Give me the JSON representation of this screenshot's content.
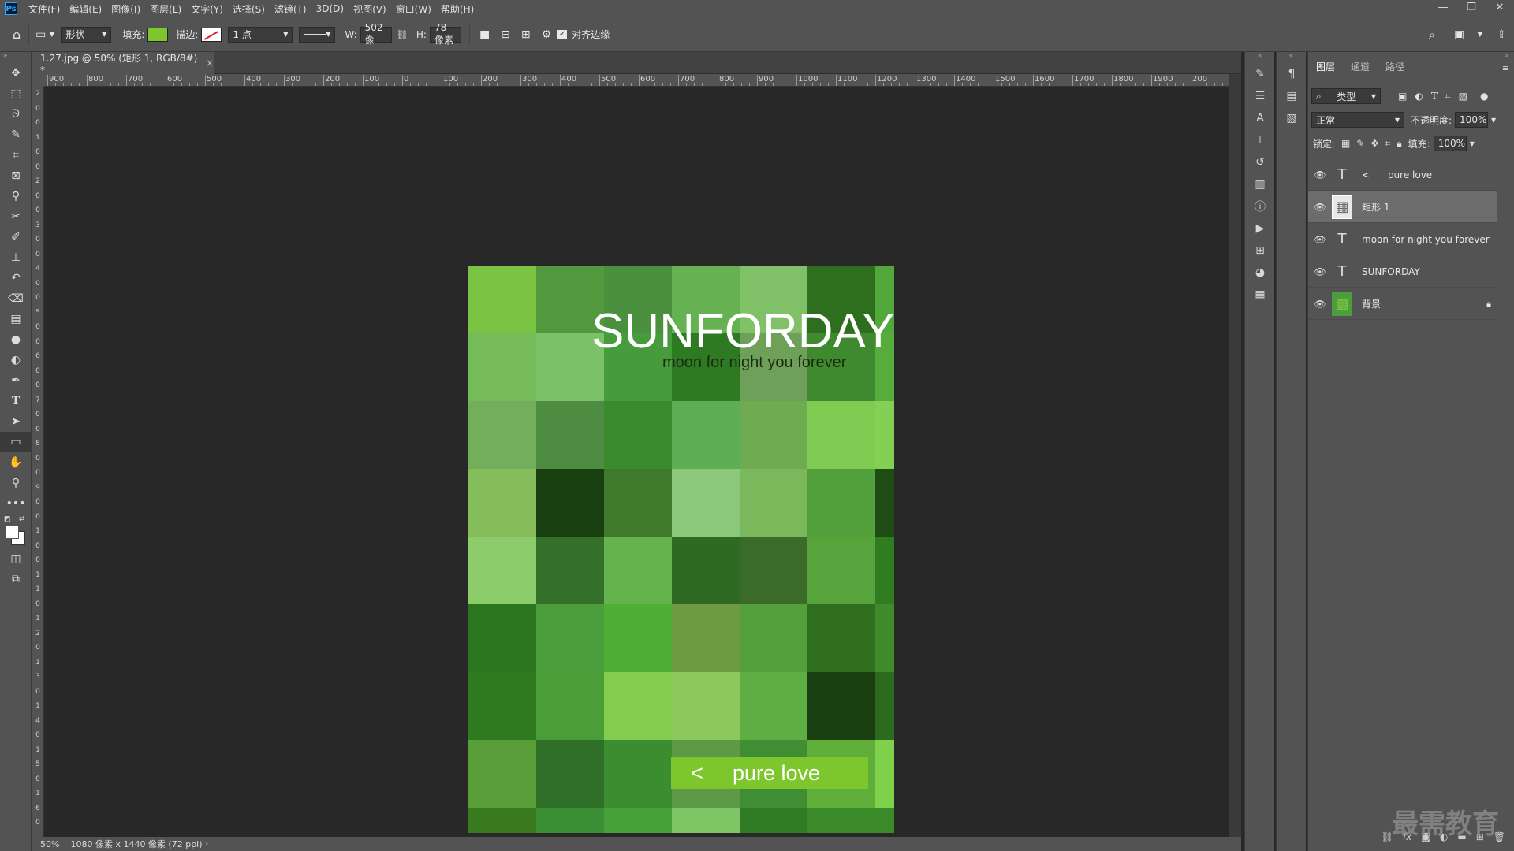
{
  "app": {
    "logo": "Ps"
  },
  "menu": [
    "文件(F)",
    "编辑(E)",
    "图像(I)",
    "图层(L)",
    "文字(Y)",
    "选择(S)",
    "滤镜(T)",
    "3D(D)",
    "视图(V)",
    "窗口(W)",
    "帮助(H)"
  ],
  "window_controls": {
    "minimize": "—",
    "restore": "❐",
    "close": "✕"
  },
  "options": {
    "mode": "形状",
    "fill_label": "填充:",
    "fill_color": "#7ec62d",
    "stroke_label": "描边:",
    "stroke_size": "1 点",
    "w_label": "W:",
    "w_value": "502 像",
    "h_label": "H:",
    "h_value": "78 像素",
    "align_edges_label": "对齐边缘"
  },
  "document": {
    "tab_title": "1.27.jpg @ 50% (矩形 1, RGB/8#) *",
    "tab_close": "×"
  },
  "ruler_h": [
    "900",
    "800",
    "700",
    "600",
    "500",
    "400",
    "300",
    "200",
    "100",
    "0",
    "100",
    "200",
    "300",
    "400",
    "500",
    "600",
    "700",
    "800",
    "900",
    "1000",
    "1100",
    "1200",
    "1300",
    "1400",
    "1500",
    "1600",
    "1700",
    "1800",
    "1900",
    "200"
  ],
  "ruler_v": [
    "2",
    "0",
    "0",
    "1",
    "0",
    "0",
    "2",
    "0",
    "0",
    "3",
    "0",
    "0",
    "4",
    "0",
    "0",
    "5",
    "0",
    "0",
    "6",
    "0",
    "0",
    "7",
    "0",
    "0",
    "8",
    "0",
    "0",
    "9",
    "0",
    "0",
    "1",
    "0",
    "0",
    "1",
    "1",
    "0",
    "1",
    "2",
    "0",
    "1",
    "3",
    "0",
    "1",
    "4",
    "0",
    "1",
    "5",
    "0",
    "1",
    "6",
    "0"
  ],
  "poster": {
    "title": "SUNFORDAY",
    "subtitle": "moon for night you forever",
    "button_arrow": "<",
    "button_text": "pure love",
    "tiles": [
      [
        "#7bc443",
        "#52983d",
        "#4b903f",
        "#66b152",
        "#80c066",
        "#2d6f1f",
        "#52a83a"
      ],
      [
        "#75bb59",
        "#7bc168",
        "#469c3c",
        "#2e7a22",
        "#6ea05a",
        "#3f8a2f",
        "#58ac3c"
      ],
      [
        "#73ae5a",
        "#4e8c42",
        "#3a8a2e",
        "#5dae55",
        "#6fab50",
        "#80cc52",
        "#83d054"
      ],
      [
        "#86bd5b",
        "#173f10",
        "#3f7a2c",
        "#8cc87c",
        "#7ab85b",
        "#52a03c",
        "#1f4c14"
      ],
      [
        "#8ccc6a",
        "#33702a",
        "#63b44c",
        "#2f6a22",
        "#3a6b2a",
        "#58a43c",
        "#2f7d1f"
      ],
      [
        "#2c751f",
        "#4c9e3c",
        "#4fae36",
        "#6e9a44",
        "#53a03c",
        "#2f6f1f",
        "#3f8a2a"
      ],
      [
        "#2f7a1f",
        "#4a9e3a",
        "#82cc4e",
        "#8cc85c",
        "#5fae44",
        "#1a3f10",
        "#2c6b1f"
      ],
      [
        "#5a9e3a",
        "#2f7028",
        "#3a8e30",
        "#5e9a46",
        "#3f8e34",
        "#5fae3a",
        "#7fd04a"
      ],
      [
        "#3a7a1f",
        "#3a8e34",
        "#47a03a",
        "#7ec666",
        "#2f7c24",
        "#3a8a2a",
        "#3a8a2a"
      ]
    ]
  },
  "status": {
    "zoom": "50%",
    "info": "1080 像素 x 1440 像素 (72 ppi)"
  },
  "layers_panel": {
    "tabs": [
      "图层",
      "通道",
      "路径"
    ],
    "filter_label": "类型",
    "blend_mode": "正常",
    "opacity_label": "不透明度:",
    "opacity_value": "100%",
    "lock_label": "锁定:",
    "fill_label": "填充:",
    "fill_value": "100%",
    "layers": [
      {
        "type": "text",
        "icon": "T",
        "name": "<      pure love",
        "selected": false
      },
      {
        "type": "shape",
        "icon": "▦",
        "name": "矩形 1",
        "selected": true
      },
      {
        "type": "text",
        "icon": "T",
        "name": "moon for night you forever",
        "selected": false
      },
      {
        "type": "text",
        "icon": "T",
        "name": "SUNFORDAY",
        "selected": false
      },
      {
        "type": "image",
        "icon": "▩",
        "name": "背景",
        "selected": false
      }
    ]
  },
  "watermark": "最需教育"
}
